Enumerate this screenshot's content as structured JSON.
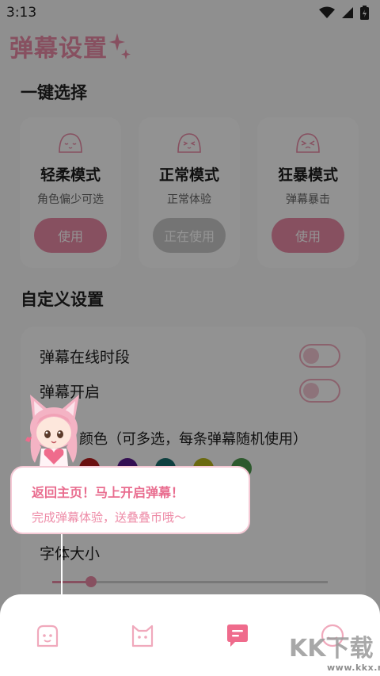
{
  "status_bar": {
    "time": "3:13",
    "icons": [
      "wifi-icon",
      "signal-icon",
      "battery-icon"
    ]
  },
  "header": {
    "title": "弹幕设置",
    "decoration": "sparkle-icon"
  },
  "quick_select": {
    "section_title": "一键选择",
    "modes": [
      {
        "name": "轻柔模式",
        "desc": "角色偏少可选",
        "button": "使用",
        "state": "available",
        "icon": "calm-face-icon"
      },
      {
        "name": "正常模式",
        "desc": "正常体验",
        "button": "正在使用",
        "state": "active",
        "icon": "normal-face-icon"
      },
      {
        "name": "狂暴模式",
        "desc": "弹幕暴击",
        "button": "使用",
        "state": "available",
        "icon": "angry-face-icon"
      }
    ]
  },
  "custom": {
    "section_title": "自定义设置",
    "settings": [
      {
        "label": "弹幕在线时段",
        "enabled": false
      },
      {
        "label": "弹幕开启",
        "enabled": false
      }
    ],
    "color_label": "颜色（可多选，每条弹幕随机使用）",
    "color_options": [
      "#b81c1c",
      "#5a1a8f",
      "#1a6e6e",
      "#b9b51a",
      "#4e9a4e"
    ],
    "font_size_label": "字体大小",
    "font_size_fraction": 0.14
  },
  "tooltip": {
    "title": "返回主页！马上开启弹幕！",
    "subtitle": "完成弹幕体验，送叠叠币哦～",
    "mascot": "cat-girl-mascot"
  },
  "bottom_nav": {
    "items": [
      "home-face-icon",
      "cat-icon",
      "danmaku-chat-icon",
      "profile-icon"
    ],
    "active_index": 2
  },
  "watermark": {
    "text": "www.kkx.net",
    "logo": "KK下载"
  },
  "colors": {
    "accent": "#e98aa6",
    "overlay": "rgba(0,0,0,0.42)"
  }
}
